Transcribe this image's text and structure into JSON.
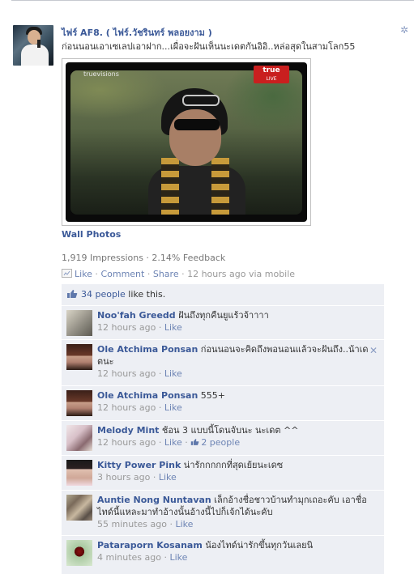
{
  "post": {
    "author": "ไฟร์ AF8. ( ไฟร์.วัชรินทร์ พลอยงาม )",
    "message": "ก่อนนอนเอาเซเลปเอาฝาก...เผื่อจะฝันเห็นนะเดตกันอิอิ..หล่อสุดในสามโลก55",
    "photo_logo_left": "truevisions",
    "photo_logo_right": "true",
    "photo_logo_right_sub": "LIVE",
    "album_link": "Wall Photos",
    "impressions": "1,919 Impressions · 2.14% Feedback",
    "actions": {
      "like": "Like",
      "comment": "Comment",
      "share": "Share",
      "timestamp": "· 12 hours ago via mobile"
    }
  },
  "likes": {
    "count_link": "34 people",
    "suffix": " like this."
  },
  "comments": [
    {
      "name": "Noo'fah Greedd",
      "text": "ฝันถึงทุกคืนยูแร้วจ้าาาา",
      "time": "12 hours ago",
      "like": "Like"
    },
    {
      "name": "Ole Atchima Ponsan",
      "text": "ก่อนนอนจะคิดถึงพอนอนแล้วจะฝันถึง..น้าเดตนะ",
      "time": "12 hours ago",
      "like": "Like"
    },
    {
      "name": "Ole Atchima Ponsan",
      "text": "555+",
      "time": "12 hours ago",
      "like": "Like"
    },
    {
      "name": "Melody Mint",
      "text": "ช้อน 3 แบบนี้โดนจับนะ นะเดต ^^",
      "time": "12 hours ago",
      "like": "Like",
      "likes": "2 people"
    },
    {
      "name": "Kitty Power Pink",
      "text": "น่ารักกกกกที่สุดเย้ยนะเดซ",
      "time": "3 hours ago",
      "like": "Like"
    },
    {
      "name": "Auntie Nong Nuntavan",
      "text": "เล็กอ้างชื่อชาวบ้านทำมุกเถอะคับ เอาชื่อไทด์นี้แหละมาทำอ้างนั้นอ้างนี้ไปก็เจ้กได้นะคับ",
      "time": "55 minutes ago",
      "like": "Like"
    },
    {
      "name": "Pataraporn Kosanam",
      "text": "น้องไทด์น่ารักขึ้นทุกวันเลยนิ",
      "time": "4 minutes ago",
      "like": "Like"
    }
  ],
  "icons": {
    "gear": "gear-icon",
    "close": "close-icon",
    "thumbs_up": "thumbs-up-icon"
  },
  "colors": {
    "link": "#3b5998",
    "ufi_background": "#edeff4",
    "meta": "#999999"
  }
}
